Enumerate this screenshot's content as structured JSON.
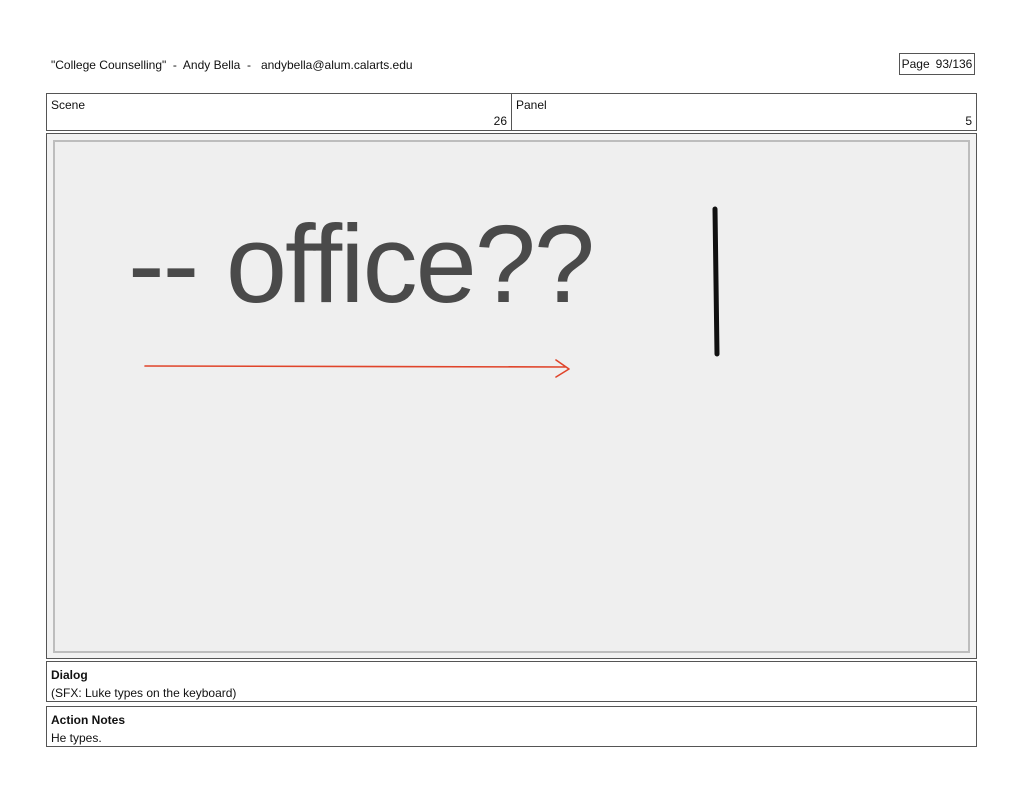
{
  "header": {
    "project": "\"College Counselling\"  -  Andy Bella  -   andybella@alum.calarts.edu",
    "page_label": "Page",
    "page_value": "93/136"
  },
  "scene": {
    "label": "Scene",
    "value": "26"
  },
  "panel": {
    "label": "Panel",
    "value": "5"
  },
  "artwork": {
    "typed_text": "-- office??",
    "arrow_color": "#e0442a",
    "cursor_color": "#111111"
  },
  "dialog": {
    "title": "Dialog",
    "text": "(SFX: Luke types on the keyboard)"
  },
  "action_notes": {
    "title": "Action Notes",
    "text": "He types."
  }
}
